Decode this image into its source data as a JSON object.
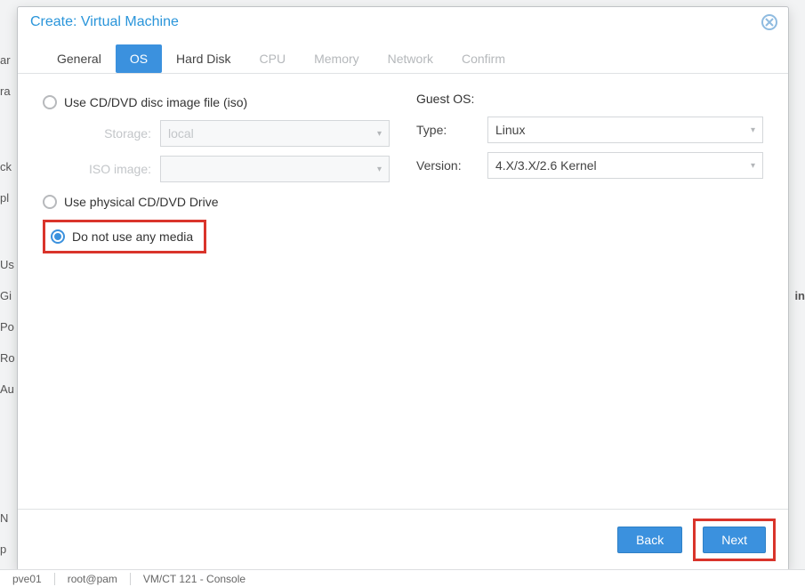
{
  "bg": {
    "items": [
      "ar",
      "ra",
      "ck",
      "pl",
      "Us",
      "Gi",
      "Po",
      "Ro",
      "Au",
      "N",
      "p"
    ],
    "right_fragment": "in"
  },
  "dialog": {
    "title": "Create: Virtual Machine"
  },
  "tabs": {
    "general": "General",
    "os": "OS",
    "harddisk": "Hard Disk",
    "cpu": "CPU",
    "memory": "Memory",
    "network": "Network",
    "confirm": "Confirm"
  },
  "media": {
    "use_iso": "Use CD/DVD disc image file (iso)",
    "storage_label": "Storage:",
    "storage_value": "local",
    "iso_label": "ISO image:",
    "iso_value": "",
    "use_physical": "Use physical CD/DVD Drive",
    "no_media": "Do not use any media"
  },
  "guest": {
    "heading": "Guest OS:",
    "type_label": "Type:",
    "type_value": "Linux",
    "version_label": "Version:",
    "version_value": "4.X/3.X/2.6 Kernel"
  },
  "footer": {
    "back": "Back",
    "next": "Next"
  },
  "status": {
    "host": "pve01",
    "user": "root@pam",
    "vm": "VM/CT 121 - Console"
  }
}
